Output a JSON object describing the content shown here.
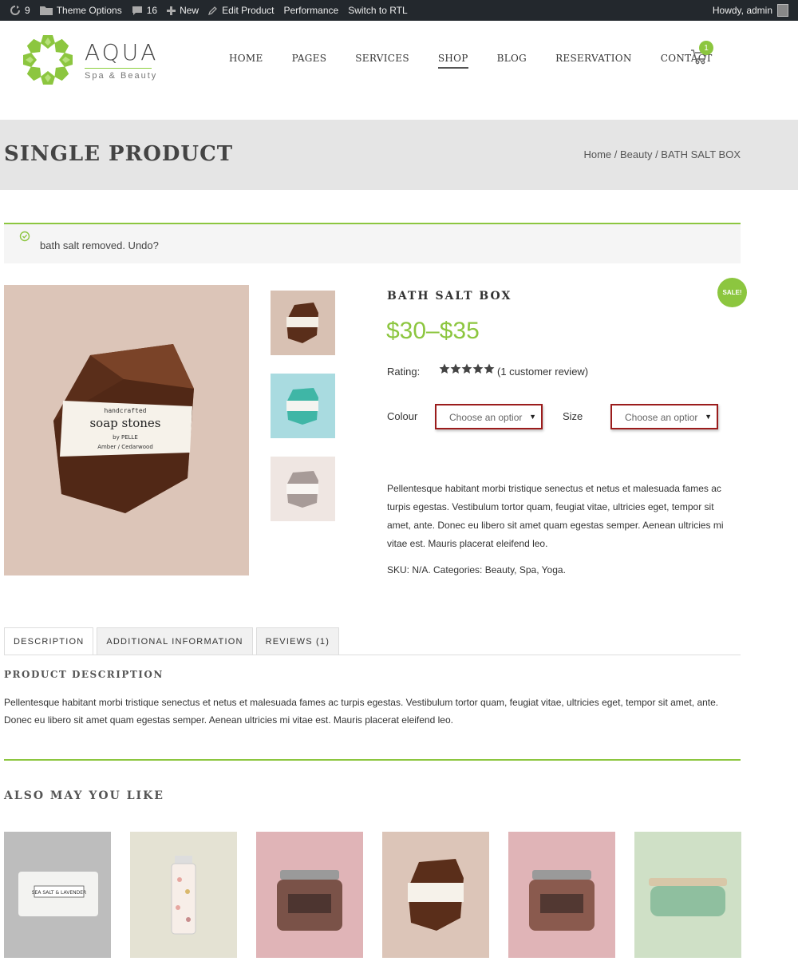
{
  "adminbar": {
    "updates": "9",
    "theme_options": "Theme Options",
    "comments": "16",
    "new": "New",
    "edit_product": "Edit Product",
    "performance": "Performance",
    "switch_rtl": "Switch to RTL",
    "howdy": "Howdy, admin"
  },
  "logo": {
    "name": "AQUA",
    "tagline": "Spa & Beauty"
  },
  "nav": [
    "HOME",
    "PAGES",
    "SERVICES",
    "SHOP",
    "BLOG",
    "RESERVATION",
    "CONTACT"
  ],
  "cart": {
    "count": "1"
  },
  "page": {
    "title": "SINGLE PRODUCT",
    "breadcrumb": "Home / Beauty / BATH SALT BOX"
  },
  "notice": {
    "text": "bath salt removed. Undo?"
  },
  "product": {
    "title": "BATH SALT BOX",
    "sale": "SALE!",
    "price": "$30–$35",
    "rating_label": "Rating:",
    "rating_stars": 5,
    "review_link": "(1 customer review)",
    "colour_label": "Colour",
    "size_label": "Size",
    "colour_select": "Choose an optior",
    "size_select": "Choose an optior",
    "short_description": "Pellentesque habitant morbi tristique senectus et netus et malesuada fames ac turpis egestas. Vestibulum tortor quam, feugiat vitae, ultricies eget, tempor sit amet, ante. Donec eu libero sit amet quam egestas semper. Aenean ultricies mi vitae est. Mauris placerat eleifend leo.",
    "meta": "SKU: N/A.   Categories: Beauty, Spa, Yoga.",
    "soap_label": {
      "small": "handcrafted",
      "big": "soap stones",
      "brand": "by PELLE",
      "scent": "Amber / Cedarwood"
    }
  },
  "tabs": [
    "DESCRIPTION",
    "ADDITIONAL INFORMATION",
    "REVIEWS (1)"
  ],
  "description": {
    "heading": "PRODUCT DESCRIPTION",
    "body": "Pellentesque habitant morbi tristique senectus et netus et malesuada fames ac turpis egestas. Vestibulum tortor quam, feugiat vitae, ultricies eget, tempor sit amet, ante. Donec eu libero sit amet quam egestas semper. Aenean ultricies mi vitae est. Mauris placerat eleifend leo."
  },
  "related": {
    "heading": "ALSO MAY YOU LIKE",
    "soap_label": "SEA SALT & LAVENDER"
  },
  "colors": {
    "accent": "#8cc63f",
    "adminbar": "#23282d",
    "titlebar": "#e5e5e5",
    "select_border": "#9b1c1c"
  }
}
